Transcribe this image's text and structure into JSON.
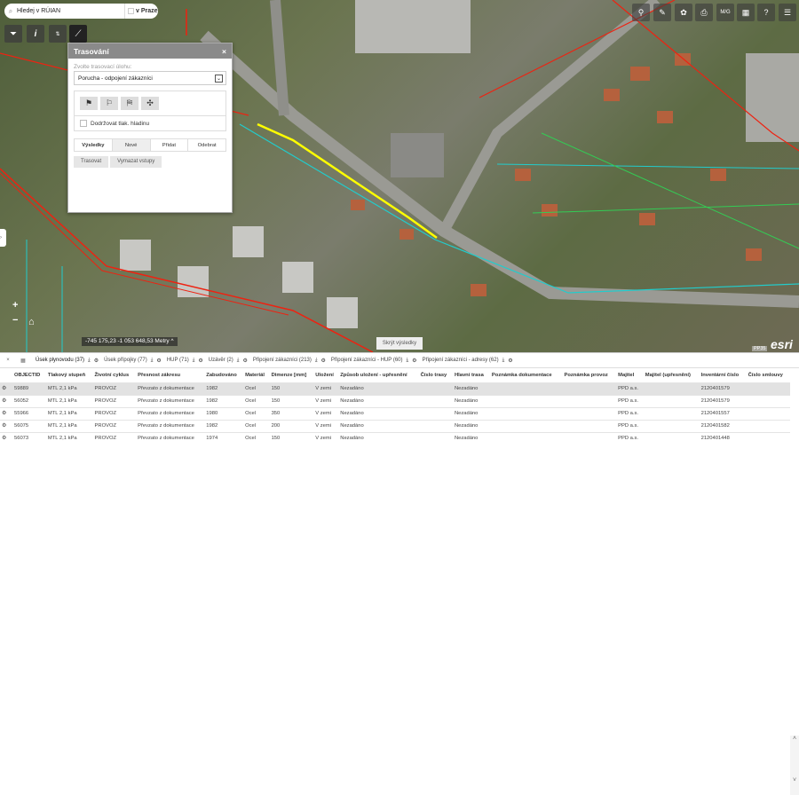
{
  "search": {
    "placeholder": "Hledej v RÚIAN",
    "city_label": "v Praze"
  },
  "map_tools": {
    "filter": "filter-icon",
    "info": "info-icon",
    "scale": "scale-icon",
    "trace": "trace-icon"
  },
  "dialog": {
    "title": "Trasování",
    "close": "×",
    "task_label": "Zvolte trasovací úlohu:",
    "task_value": "Porucha - odpojení zákazníci",
    "flag_icons": [
      "⚑",
      "⚐",
      "⛿",
      "✣"
    ],
    "checkbox_label": "Dodržovat tlak. hladinu",
    "tabs": [
      "Výsledky",
      "Nové",
      "Přidat",
      "Odebrat"
    ],
    "buttons": [
      "Trasovat",
      "Vymazat vstupy"
    ]
  },
  "top_tools": [
    "⚲",
    "✎",
    "✿",
    "⎙",
    "M/G",
    "▦",
    "?",
    "☰"
  ],
  "zoom": {
    "plus": "+",
    "minus": "−",
    "home": "⌂"
  },
  "coords": {
    "text": "-745 175,23 -1 053 648,53 Metry",
    "toggle": "^"
  },
  "hide_results": "Skrýt výsledky",
  "attribution": {
    "logo": "esri",
    "badge": "PP35"
  },
  "results": {
    "close": "×",
    "tabs": [
      {
        "label": "Úsek plynovodu (37)"
      },
      {
        "label": "Úsek přípojky (77)"
      },
      {
        "label": "HUP (71)"
      },
      {
        "label": "Uzávěr (2)"
      },
      {
        "label": "Připojení zákazníci (213)"
      },
      {
        "label": "Připojení zákazníci - HUP (60)"
      },
      {
        "label": "Připojení zákazníci - adresy (62)"
      }
    ],
    "columns": [
      "",
      "OBJECTID",
      "Tlakový stupeň",
      "Životní cyklus",
      "Přesnost zákresu",
      "Zabudováno",
      "Materiál",
      "Dimenze [mm]",
      "Uložení",
      "Způsob uložení - upřesnění",
      "Číslo trasy",
      "Hlavní trasa",
      "Poznámka dokumentace",
      "Poznámka provoz",
      "Majitel",
      "Majitel (upřesnění)",
      "Inventární číslo",
      "Číslo smlouvy"
    ],
    "rows": [
      [
        "59889",
        "MTL 2,1 kPa",
        "PROVOZ",
        "Převzato z dokumentace",
        "1982",
        "Ocel",
        "150",
        "V zemi",
        "Nezadáno",
        "",
        "Nezadáno",
        "",
        "",
        "PPD a.s.",
        "",
        "2120401579",
        ""
      ],
      [
        "56052",
        "MTL 2,1 kPa",
        "PROVOZ",
        "Převzato z dokumentace",
        "1982",
        "Ocel",
        "150",
        "V zemi",
        "Nezadáno",
        "",
        "Nezadáno",
        "",
        "",
        "PPD a.s.",
        "",
        "2120401579",
        ""
      ],
      [
        "55966",
        "MTL 2,1 kPa",
        "PROVOZ",
        "Převzato z dokumentace",
        "1980",
        "Ocel",
        "350",
        "V zemi",
        "Nezadáno",
        "",
        "Nezadáno",
        "",
        "",
        "PPD a.s.",
        "",
        "2120401557",
        ""
      ],
      [
        "56075",
        "MTL 2,1 kPa",
        "PROVOZ",
        "Převzato z dokumentace",
        "1982",
        "Ocel",
        "200",
        "V zemi",
        "Nezadáno",
        "",
        "Nezadáno",
        "",
        "",
        "PPD a.s.",
        "",
        "2120401582",
        ""
      ],
      [
        "56073",
        "MTL 2,1 kPa",
        "PROVOZ",
        "Převzato z dokumentace",
        "1974",
        "Ocel",
        "150",
        "V zemi",
        "Nezadáno",
        "",
        "Nezadáno",
        "",
        "",
        "PPD a.s.",
        "",
        "2120401448",
        ""
      ]
    ]
  }
}
